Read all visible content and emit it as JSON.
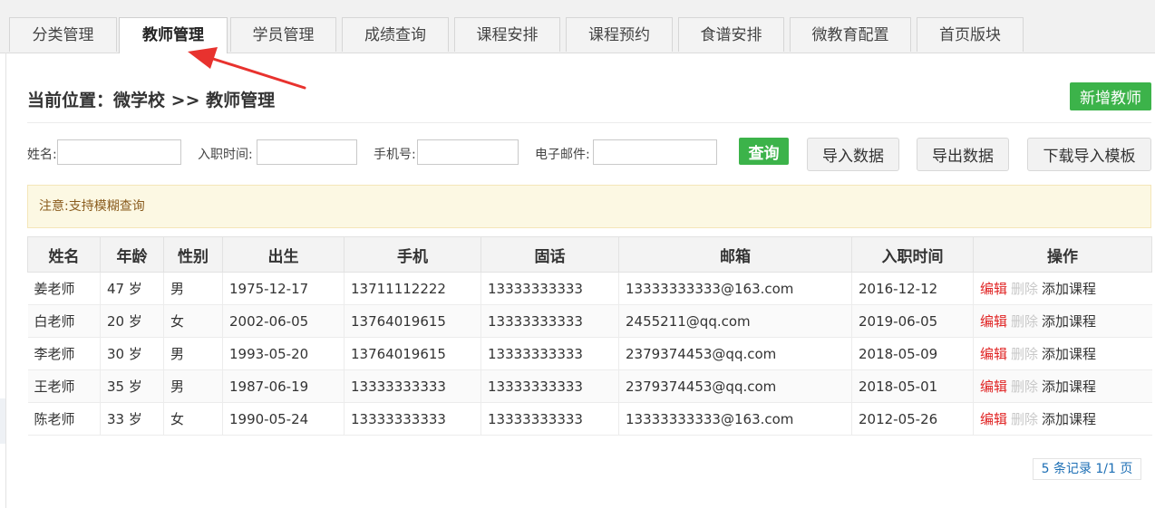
{
  "tabs": [
    {
      "label": "分类管理",
      "active": false
    },
    {
      "label": "教师管理",
      "active": true
    },
    {
      "label": "学员管理",
      "active": false
    },
    {
      "label": "成绩查询",
      "active": false
    },
    {
      "label": "课程安排",
      "active": false
    },
    {
      "label": "课程预约",
      "active": false
    },
    {
      "label": "食谱安排",
      "active": false
    },
    {
      "label": "微教育配置",
      "active": false
    },
    {
      "label": "首页版块",
      "active": false
    }
  ],
  "location": {
    "prefix": "当前位置：",
    "school": "微学校",
    "separator": ">>",
    "page": "教师管理"
  },
  "buttons": {
    "add_teacher": "新增教师",
    "search": "查询",
    "import": "导入数据",
    "export": "导出数据",
    "download_template": "下载导入模板"
  },
  "filters": {
    "name_label": "姓名:",
    "hire_date_label": "入职时间:",
    "phone_label": "手机号:",
    "email_label": "电子邮件:",
    "name_value": "",
    "hire_date_value": "",
    "phone_value": "",
    "email_value": ""
  },
  "notice": "注意:支持模糊查询",
  "table": {
    "headers": [
      "姓名",
      "年龄",
      "性别",
      "出生",
      "手机",
      "固话",
      "邮箱",
      "入职时间",
      "操作"
    ],
    "rows": [
      [
        "姜老师",
        "47 岁",
        "男",
        "1975-12-17",
        "13711112222",
        "13333333333",
        "13333333333@163.com",
        "2016-12-12"
      ],
      [
        "白老师",
        "20 岁",
        "女",
        "2002-06-05",
        "13764019615",
        "13333333333",
        "2455211@qq.com",
        "2019-06-05"
      ],
      [
        "李老师",
        "30 岁",
        "男",
        "1993-05-20",
        "13764019615",
        "13333333333",
        "2379374453@qq.com",
        "2018-05-09"
      ],
      [
        "王老师",
        "35 岁",
        "男",
        "1987-06-19",
        "13333333333",
        "13333333333",
        "2379374453@qq.com",
        "2018-05-01"
      ],
      [
        "陈老师",
        "33 岁",
        "女",
        "1990-05-24",
        "13333333333",
        "13333333333",
        "13333333333@163.com",
        "2012-05-26"
      ]
    ],
    "actions": {
      "edit": "编辑",
      "delete": "删除",
      "add_course": "添加课程"
    }
  },
  "pager": "5 条记录 1/1 页",
  "colors": {
    "green": "#3cb34a",
    "edit_red": "#e02424",
    "arrow_red": "#e8322e",
    "pager_blue": "#1d6fb5"
  }
}
